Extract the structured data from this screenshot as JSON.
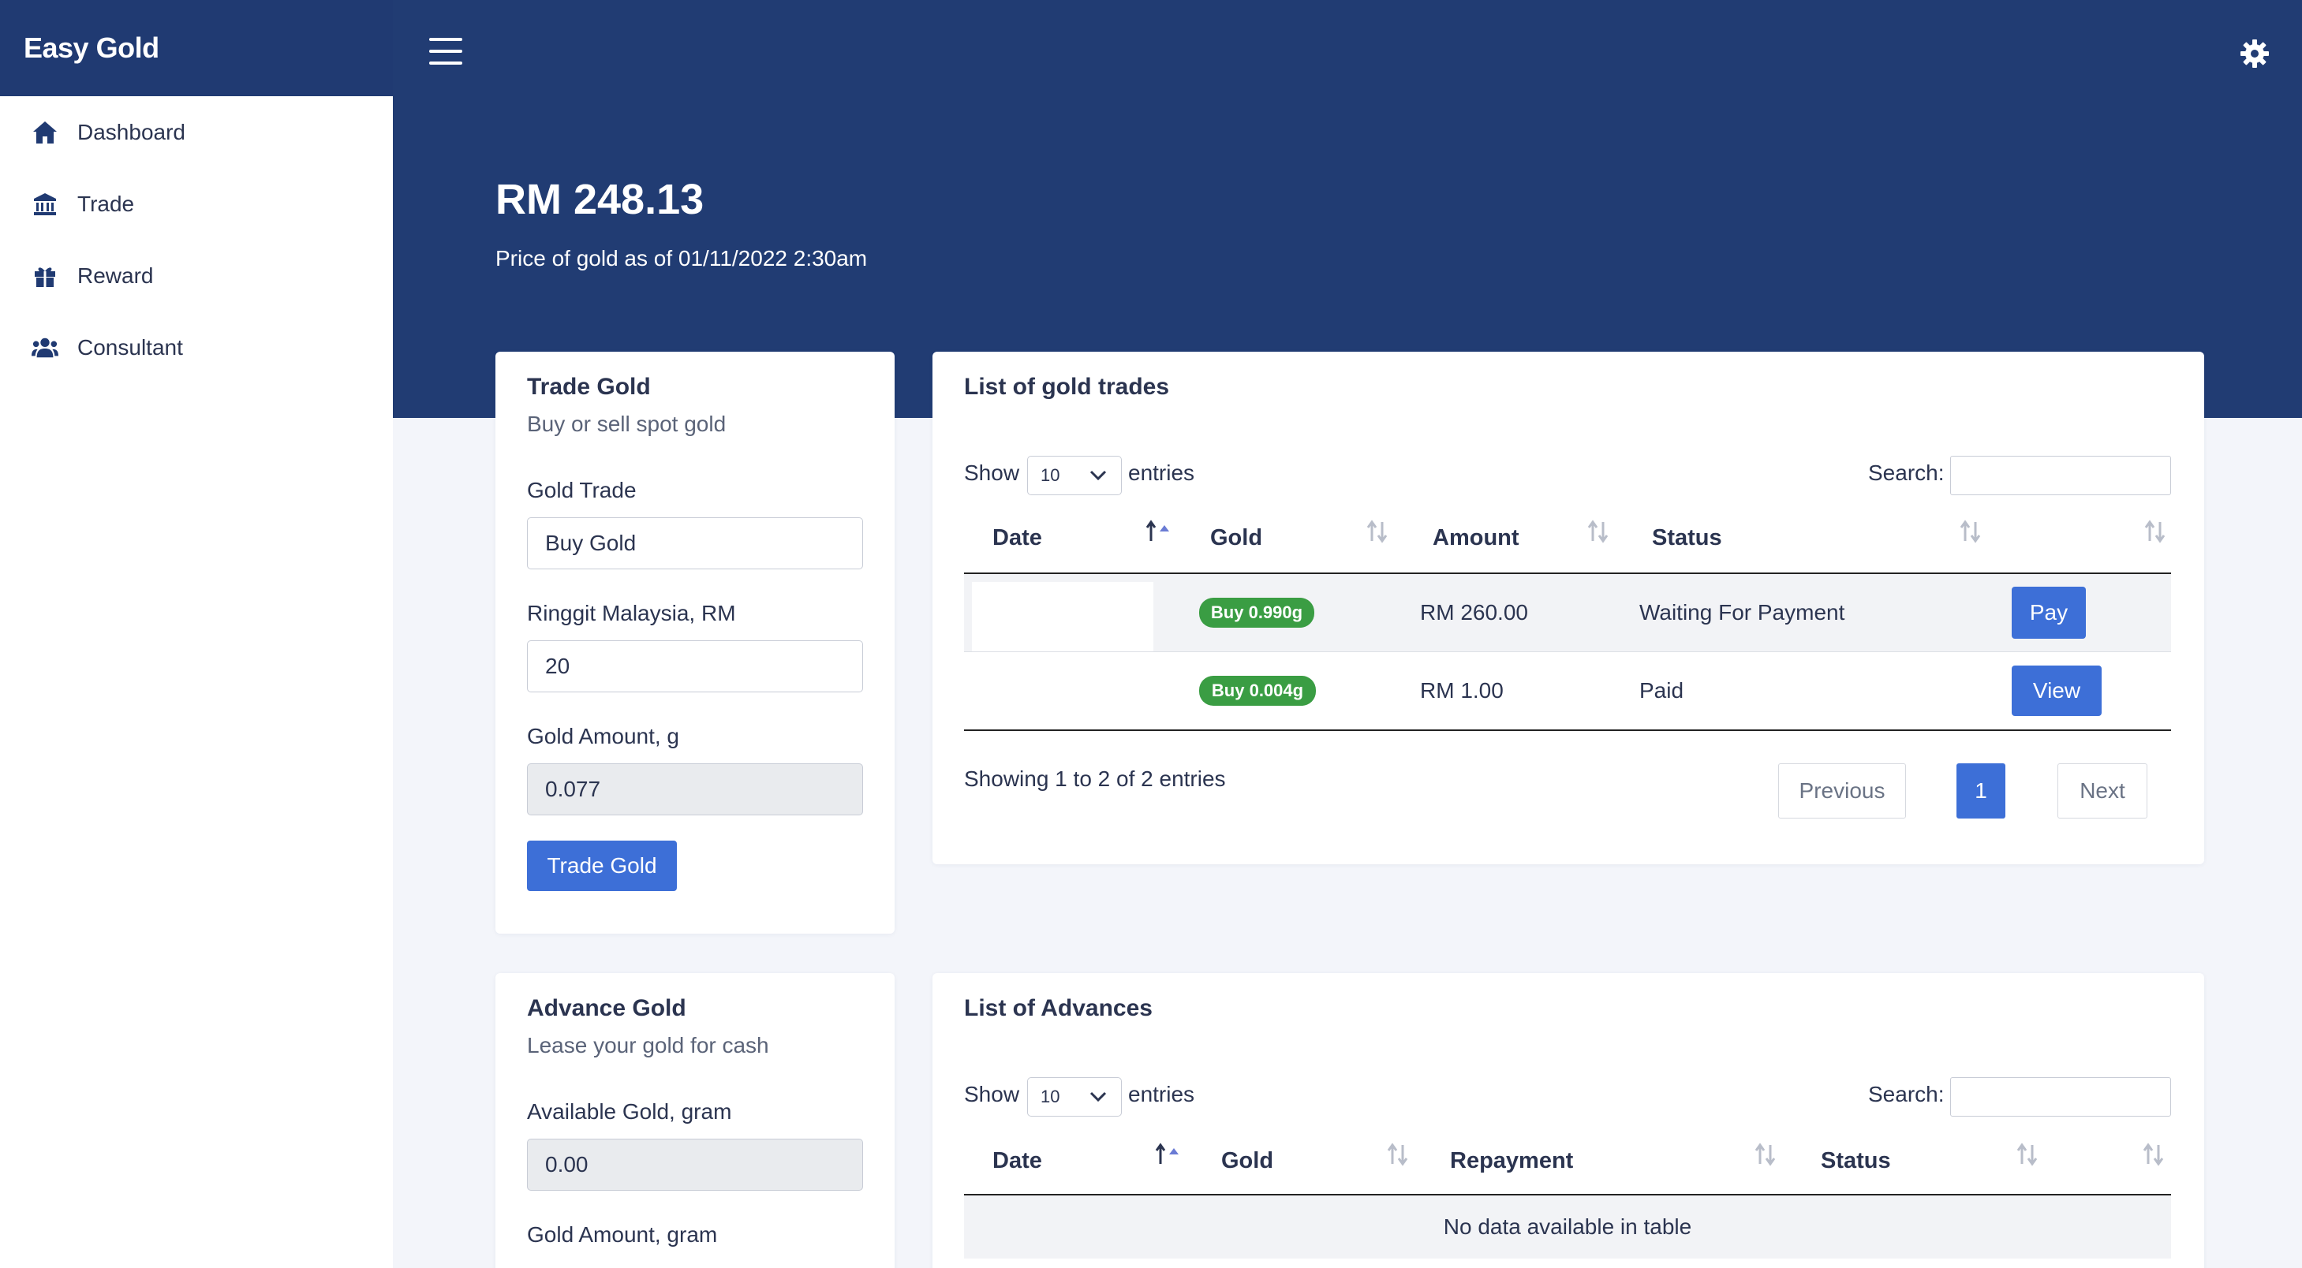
{
  "app": {
    "brand": "Easy Gold"
  },
  "sidebar": {
    "items": [
      {
        "label": "Dashboard",
        "icon": "home-icon"
      },
      {
        "label": "Trade",
        "icon": "bank-icon"
      },
      {
        "label": "Reward",
        "icon": "gift-icon"
      },
      {
        "label": "Consultant",
        "icon": "users-icon"
      }
    ]
  },
  "header": {
    "price": "RM 248.13",
    "price_caption": "Price of gold as of 01/11/2022 2:30am"
  },
  "trade_card": {
    "title": "Trade Gold",
    "subtitle": "Buy or sell spot gold",
    "trade_label": "Gold Trade",
    "trade_value": "Buy Gold",
    "rm_label": "Ringgit Malaysia, RM",
    "rm_value": "20",
    "gold_label": "Gold Amount, g",
    "gold_value": "0.077",
    "button": "Trade Gold"
  },
  "trades_table": {
    "title": "List of gold trades",
    "show_label": "Show",
    "entries_value": "10",
    "entries_label": "entries",
    "search_label": "Search:",
    "columns": [
      "Date",
      "Gold",
      "Amount",
      "Status"
    ],
    "rows": [
      {
        "date": "",
        "gold": "Buy 0.990g",
        "amount": "RM 260.00",
        "status": "Waiting For Payment",
        "action": "Pay"
      },
      {
        "date": "",
        "gold": "Buy 0.004g",
        "amount": "RM 1.00",
        "status": "Paid",
        "action": "View"
      }
    ],
    "info": "Showing 1 to 2 of 2 entries",
    "prev": "Previous",
    "page": "1",
    "next": "Next"
  },
  "advance_card": {
    "title": "Advance Gold",
    "subtitle": "Lease your gold for cash",
    "available_label": "Available Gold, gram",
    "available_value": "0.00",
    "amount_label": "Gold Amount, gram"
  },
  "advances_table": {
    "title": "List of Advances",
    "show_label": "Show",
    "entries_value": "10",
    "entries_label": "entries",
    "search_label": "Search:",
    "columns": [
      "Date",
      "Gold",
      "Repayment",
      "Status"
    ],
    "empty": "No data available in table"
  },
  "colors": {
    "navy": "#213c73",
    "primary": "#3d6fd7",
    "success": "#3a9d43"
  }
}
